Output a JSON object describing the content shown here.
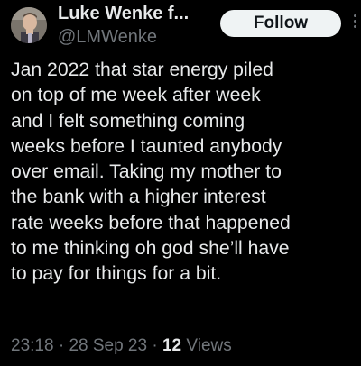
{
  "author": {
    "display_name": "Luke Wenke f...",
    "handle": "@LMWenke",
    "avatar_icon": "profile-photo"
  },
  "follow_button": {
    "label": "Follow"
  },
  "more_menu": {
    "icon": "vertical-ellipsis-icon"
  },
  "tweet": {
    "text": "Jan 2022 that star energy piled\non top of me week after week\nand I felt something coming\nweeks before I taunted anybody\nover email. Taking my mother to\nthe bank with a higher interest\nrate weeks before that happened\nto me thinking oh god she’ll have\nto pay for things for a bit.",
    "time": "23:18",
    "separator_1": "·",
    "date": "28 Sep 23",
    "separator_2": "·",
    "views_count": "12",
    "views_label": "Views"
  },
  "colors": {
    "background": "#000000",
    "primary_text": "#e7e9ea",
    "secondary_text": "#71767b",
    "follow_button_bg": "#eff3f4",
    "follow_button_text": "#0f1419"
  }
}
